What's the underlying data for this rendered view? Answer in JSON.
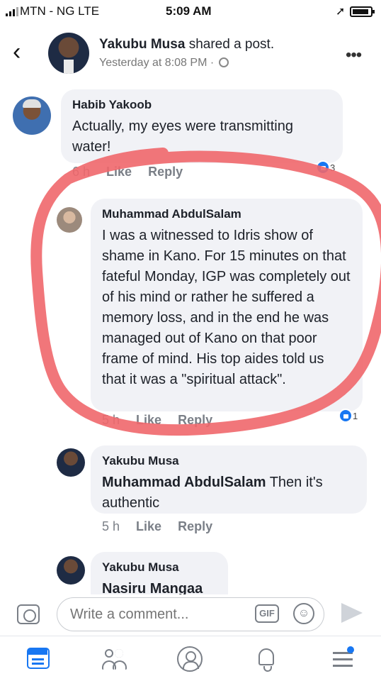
{
  "status_bar": {
    "carrier": "MTN - NG  LTE",
    "time": "5:09 AM"
  },
  "header": {
    "user_name": "Yakubu Musa",
    "action_text": " shared a post.",
    "timestamp": "Yesterday at 8:08 PM ·"
  },
  "comments": [
    {
      "author": "Habib Yakoob",
      "text": "Actually, my eyes were transmitting water!",
      "time": "6 h",
      "like_label": "Like",
      "reply_label": "Reply",
      "reaction_count": "3"
    },
    {
      "author": "Muhammad AbdulSalam",
      "text": "I was a witnessed to Idris show of shame in Kano. For 15 minutes on that fateful Monday,  IGP was completely out of his mind or rather he suffered a memory loss, and in the end he was managed out of Kano on that poor frame of mind.  His top aides told us that it was a \"spiritual attack\".",
      "time": "5 h",
      "like_label": "Like",
      "reply_label": "Reply",
      "reaction_count": "1"
    },
    {
      "author": "Yakubu Musa",
      "mention": "Muhammad AbdulSalam",
      "text": " Then it's authentic",
      "time": "5 h",
      "like_label": "Like",
      "reply_label": "Reply"
    },
    {
      "author": "Yakubu Musa",
      "mention": "Nasiru Mangaa"
    }
  ],
  "composer": {
    "placeholder": "Write a comment...",
    "gif_label": "GIF"
  },
  "colors": {
    "accent": "#1877f2",
    "highlight": "#f0676b",
    "bubble": "#f1f2f6"
  },
  "icons": [
    "signal-icon",
    "location-arrow-icon",
    "battery-icon",
    "back-chevron-icon",
    "globe-icon",
    "more-icon",
    "like-reaction-icon",
    "camera-icon",
    "gif-icon",
    "emoji-icon",
    "send-icon",
    "news-feed-icon",
    "friends-icon",
    "profile-icon",
    "notifications-icon",
    "menu-icon"
  ]
}
